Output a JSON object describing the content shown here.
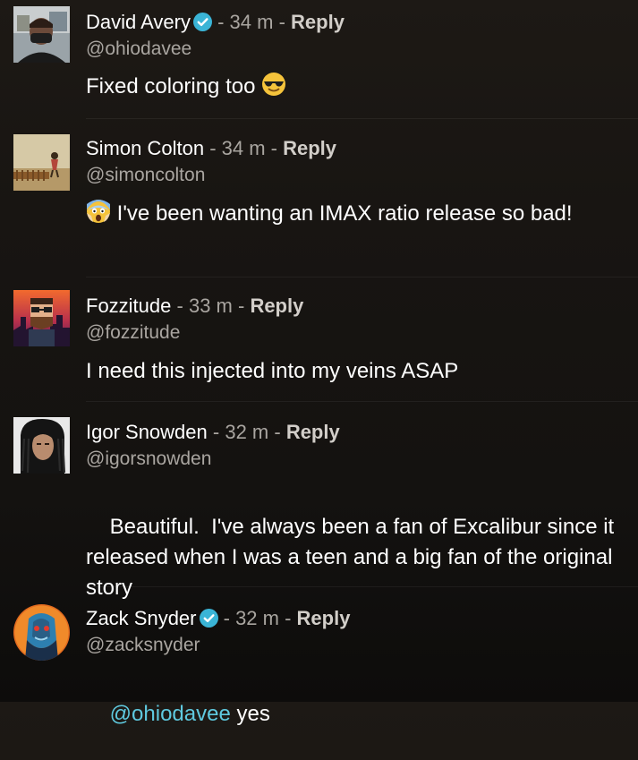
{
  "comments": [
    {
      "author": "David Avery",
      "verified": true,
      "time": "34 m",
      "reply_label": "Reply",
      "handle": "@ohiodavee",
      "text": "Fixed coloring too",
      "trailing_emoji": "smiling-face-with-sunglasses"
    },
    {
      "author": "Simon Colton",
      "verified": false,
      "time": "34 m",
      "reply_label": "Reply",
      "handle": "@simoncolton",
      "leading_emoji": "face-screaming-in-fear",
      "text": "I've been wanting an IMAX ratio release so bad!"
    },
    {
      "author": "Fozzitude",
      "verified": false,
      "time": "33 m",
      "reply_label": "Reply",
      "handle": "@fozzitude",
      "text": "I need this injected into my veins ASAP"
    },
    {
      "author": "Igor Snowden",
      "verified": false,
      "time": "32 m",
      "reply_label": "Reply",
      "handle": "@igorsnowden",
      "text": "Beautiful.  I've always been a fan of Excalibur since it released when I was a teen and a big fan of the original story"
    },
    {
      "author": "Zack Snyder",
      "verified": true,
      "time": "32 m",
      "reply_label": "Reply",
      "handle": "@zacksnyder",
      "mention": "@ohiodavee",
      "text": " yes"
    }
  ],
  "separator": " - ",
  "colors": {
    "background": "#181512",
    "mention": "#5fc9df",
    "verified_badge": "#3ab4d6",
    "muted_text": "#a9a5a0"
  }
}
